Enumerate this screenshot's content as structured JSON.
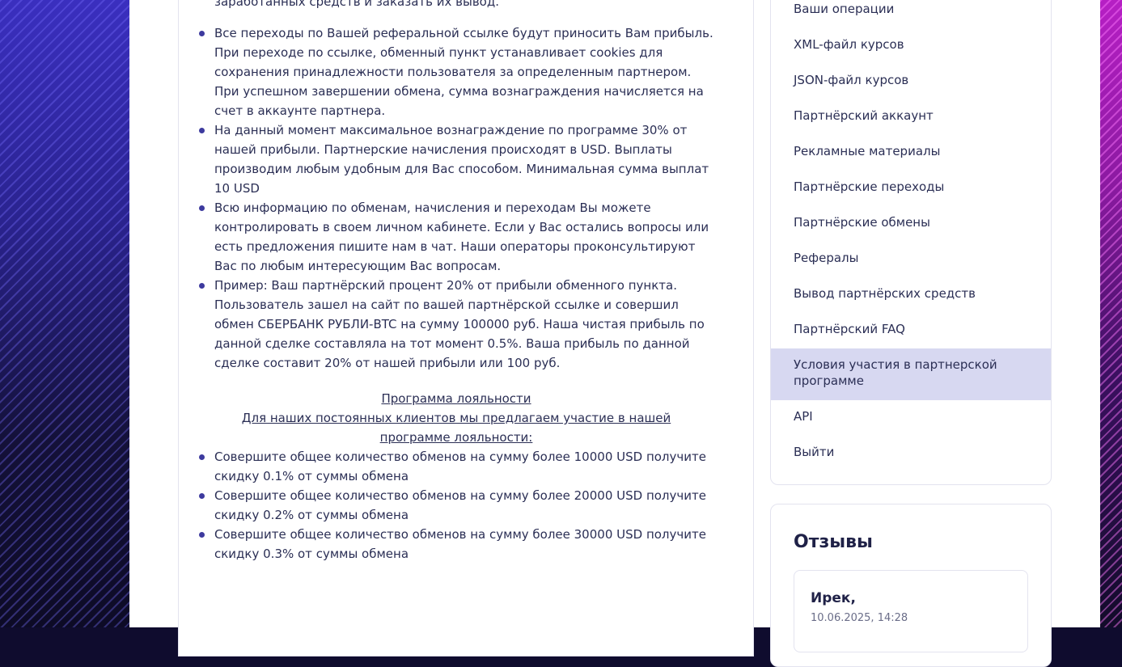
{
  "content": {
    "top_partial": "заработанных средств и заказать их вывод.",
    "bullets": [
      "Все переходы по Вашей реферальной ссылке будут приносить Вам прибыль. При переходе по ссылке, обменный пункт устанавливает cookies для сохранения принадлежности пользователя за определенным партнером. При успешном завершении обмена, сумма вознаграждения начисляется на счет в аккаунте партнера.",
      "На данный момент максимальное вознаграждение по программе 30% от нашей прибыли. Партнерские начисления происходят в USD. Выплаты производим любым удобным для Вас способом. Минимальная сумма выплат 10 USD",
      "Всю информацию по обменам, начисления и переходам Вы можете контролировать в своем личном кабинете. Если у Вас остались вопросы или есть предложения пишите нам в чат. Наши операторы проконсультируют Вас по любым интересующим Вас вопросам.",
      "Пример: Ваш партнёрский процент 20% от прибыли обменного пункта. Пользователь зашел на сайт по вашей партнёрской ссылке и совершил обмен СБЕРБАНК РУБЛИ-BTC на сумму 100000 руб. Наша чистая прибыль по данной сделке составляла на тот момент 0.5%. Ваша прибыль по данной сделке составит 20% от нашей прибыли или 100 руб."
    ],
    "loyalty_title": "Программа лояльности",
    "loyalty_subtitle": "Для наших постоянных клиентов мы предлагаем участие в нашей программе лояльности:",
    "loyalty_bullets": [
      "Совершите общее количество обменов на сумму более 10000 USD получите скидку 0.1% от суммы обмена",
      "Совершите общее количество обменов на сумму более 20000 USD получите скидку 0.2% от суммы обмена",
      "Совершите общее количество обменов на сумму более 30000 USD получите скидку 0.3% от суммы обмена"
    ]
  },
  "sidebar": {
    "items": [
      "Ваши операции",
      "XML-файл курсов",
      "JSON-файл курсов",
      "Партнёрский аккаунт",
      "Рекламные материалы",
      "Партнёрские переходы",
      "Партнёрские обмены",
      "Рефералы",
      "Вывод партнёрских средств",
      "Партнёрский FAQ",
      "Условия участия в партнерской программе",
      "API",
      "Выйти"
    ],
    "active": "Условия участия в партнерской программе"
  },
  "reviews": {
    "title": "Отзывы",
    "first": {
      "name": "Ирек,",
      "date": "10.06.2025, 14:28"
    }
  },
  "colors": {
    "text": "#2b2f55",
    "active_bg": "#d7d8f1",
    "bullet": "#3d3a9e"
  }
}
